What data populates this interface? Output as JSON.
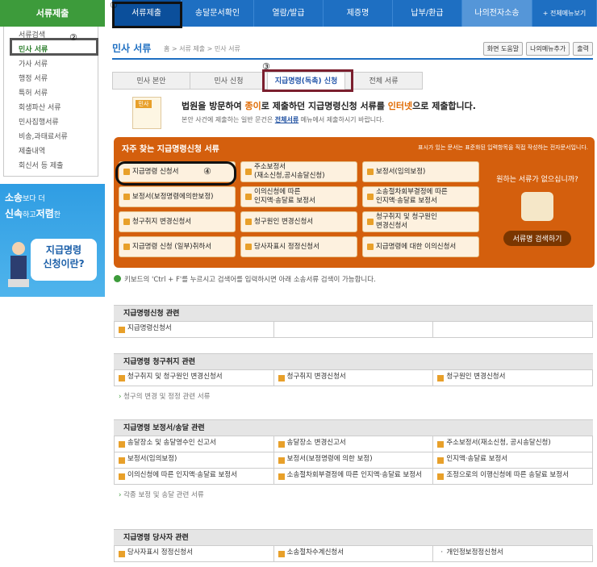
{
  "sidebar": {
    "title": "서류제출",
    "items": [
      "서류검색",
      "민사 서류",
      "가사 서류",
      "행정 서류",
      "특허 서류",
      "회생파산 서류",
      "민사집행서류",
      "비송,과태료서류",
      "제출내역",
      "회신서 등 제출"
    ],
    "banner": {
      "line1a": "소송",
      "line1b": "보다 더",
      "line2a": "신속",
      "line2b": "하고",
      "line2c": "저렴",
      "line2d": "한",
      "bubble1": "지급명령",
      "bubble2": "신청이란?"
    }
  },
  "annotations": {
    "n1": "①",
    "n2": "②",
    "n3": "③",
    "n4": "④"
  },
  "topnav": [
    "서류제출",
    "송달문서확인",
    "열람/발급",
    "제증명",
    "납부/환급",
    "나의전자소송",
    "+ 전체메뉴보기"
  ],
  "page": {
    "title": "민사 서류",
    "breadcrumb": "홈 > 서류 제출 > 민사 서류"
  },
  "tools": [
    "화면 도움말",
    "나의메뉴추가",
    "출력"
  ],
  "tabs": [
    "민사 본안",
    "민사 신청",
    "지급명령(독촉) 신청",
    "전체 서류"
  ],
  "notice": {
    "icon_label": "민사",
    "main_a": "법원을 방문하여 ",
    "main_b": "종이",
    "main_c": "로 제출하던 지급명령신청 서류를 ",
    "main_d": "인터넷",
    "main_e": "으로 제출합니다.",
    "sub_a": "본안 사건에 제출하는 일반 문건은 ",
    "sub_link": "전체서류",
    "sub_b": " 메뉴에서 제출하시기 바랍니다."
  },
  "frequent": {
    "title": "자주 찾는 지급명령신청 서류",
    "note": "표시가 있는 문서는 표준화된 입력항목을 직접 작성하는 전자문서입니다.",
    "buttons": [
      "지급명령 신청서",
      "주소보정서\n(재소신청,공시송달신청)",
      "보정서(임의보정)",
      "보정서(보정명령에의한보정)",
      "이의신청에 따른\n인지액·송달료 보정서",
      "소송절차회부결정에 따른\n인지액·송달료 보정서",
      "청구취지 변경신청서",
      "청구원인 변경신청서",
      "청구취지 및 청구원인\n변경신청서",
      "지급명령 신청 (일부)취하서",
      "당사자표시 정정신청서",
      "지급명령에 대한 이의신청서"
    ],
    "right_question": "원하는 서류가 없으십니까?",
    "right_button": "서류명 검색하기"
  },
  "hint": "키보드의 'Ctrl + F'를 누르시고 검색어를 입력하시면 아래 소송서류 검색이 가능합니다.",
  "sections": [
    {
      "title": "지급명령신청 관련",
      "cells": [
        "지급명령신청서",
        "",
        ""
      ],
      "more": ""
    },
    {
      "title": "지급명령 청구취지 관련",
      "cells": [
        "청구취지 및 청구원인 변경신청서",
        "청구취지 변경신청서",
        "청구원인 변경신청서"
      ],
      "more": "청구의 변경 및 정정 관련 서류"
    },
    {
      "title": "지급명령 보정서/송달 관련",
      "cells": [
        "송달장소 및 송달영수인 신고서",
        "송달장소 변경신고서",
        "주소보정서(재소신청, 공시송달신청)",
        "보정서(임의보정)",
        "보정서(보정명령에 의한 보정)",
        "인지액·송달료 보정서",
        "이의신청에 따른 인지액·송달료 보정서",
        "소송절차회부결정에 따른 인지액·송달료 보정서",
        "조정으로의 이행신청에 따른 송달료 보정서"
      ],
      "more": "각종 보정 및 송달 관련 서류"
    },
    {
      "title": "지급명령 당사자 관련",
      "cells": [
        "당사자표시 정정신청서",
        "소송절차수계신청서",
        "개인정보정정신청서"
      ],
      "more": ""
    }
  ]
}
